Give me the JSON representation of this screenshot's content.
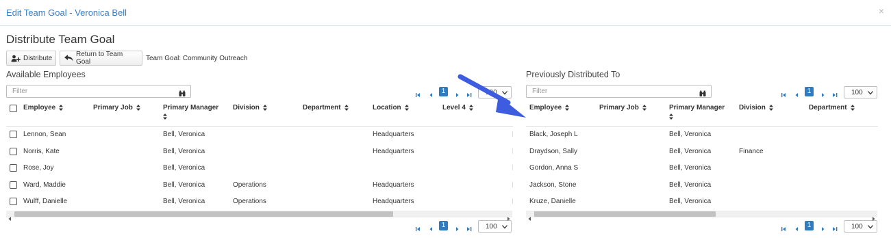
{
  "modal": {
    "title": "Edit Team Goal - Veronica Bell",
    "close": "×"
  },
  "section_title": "Distribute Team Goal",
  "toolbar": {
    "distribute_label": "Distribute",
    "return_label": "Return to Team Goal",
    "goal_text": "Team Goal: Community Outreach"
  },
  "available": {
    "title": "Available Employees",
    "filter_placeholder": "Filter",
    "page": "1",
    "page_size": "100",
    "columns": [
      "Employee",
      "Primary Job",
      "Primary Manager",
      "Division",
      "Department",
      "Location",
      "Level 4"
    ],
    "rows": [
      [
        "Lennon, Sean",
        "",
        "Bell, Veronica",
        "",
        "",
        "Headquarters",
        ""
      ],
      [
        "Norris, Kate",
        "",
        "Bell, Veronica",
        "",
        "",
        "Headquarters",
        ""
      ],
      [
        "Rose, Joy",
        "",
        "Bell, Veronica",
        "",
        "",
        "",
        ""
      ],
      [
        "Ward, Maddie",
        "",
        "Bell, Veronica",
        "Operations",
        "",
        "Headquarters",
        ""
      ],
      [
        "Wulff, Danielle",
        "",
        "Bell, Veronica",
        "Operations",
        "",
        "Headquarters",
        ""
      ]
    ]
  },
  "distributed": {
    "title": "Previously Distributed To",
    "filter_placeholder": "Filter",
    "page": "1",
    "page_size": "100",
    "columns": [
      "Employee",
      "Primary Job",
      "Primary Manager",
      "Division",
      "Department"
    ],
    "rows": [
      [
        "Black, Joseph L",
        "",
        "Bell, Veronica",
        "",
        ""
      ],
      [
        "Draydson, Sally",
        "",
        "Bell, Veronica",
        "Finance",
        ""
      ],
      [
        "Gordon, Anna S",
        "",
        "Bell, Veronica",
        "",
        ""
      ],
      [
        "Jackson, Stone",
        "",
        "Bell, Veronica",
        "",
        ""
      ],
      [
        "Kruze, Danielle",
        "",
        "Bell, Veronica",
        "",
        ""
      ]
    ]
  },
  "colors": {
    "accent": "#2e7bbf",
    "title_blue": "#3a7cc0",
    "arrow": "#3d5ce0"
  }
}
